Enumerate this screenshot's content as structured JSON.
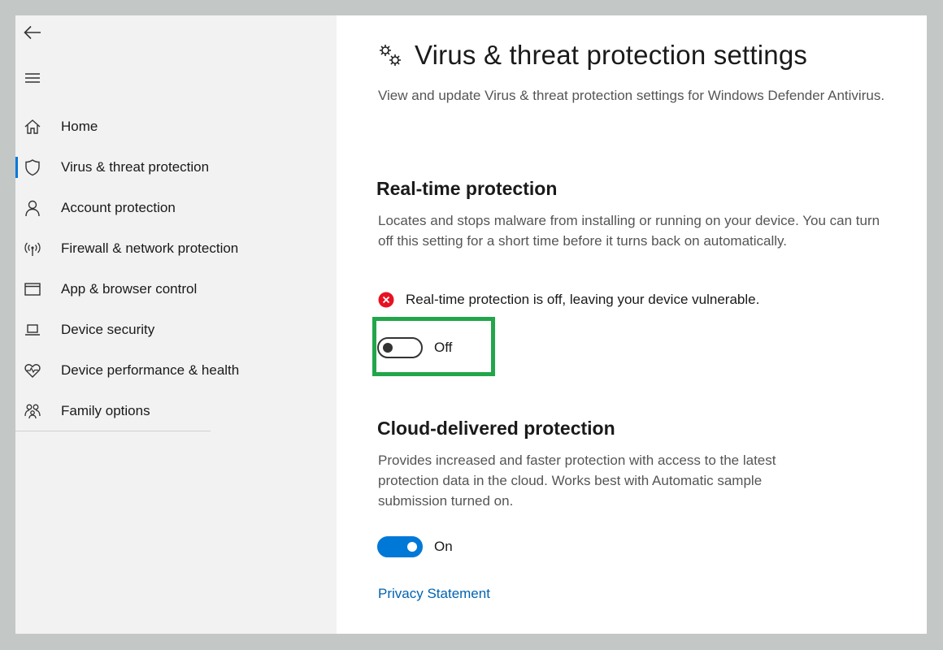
{
  "colors": {
    "accent": "#0078d7",
    "error": "#e81123",
    "highlight": "#22a64a",
    "link": "#0063b1"
  },
  "sidebar": {
    "back_icon": "back-arrow-icon",
    "menu_icon": "hamburger-menu-icon",
    "selected": "Virus & threat protection",
    "items": [
      {
        "label": "Home",
        "icon": "home-icon"
      },
      {
        "label": "Virus & threat protection",
        "icon": "shield-icon"
      },
      {
        "label": "Account protection",
        "icon": "person-icon"
      },
      {
        "label": "Firewall & network protection",
        "icon": "wireless-antenna-icon"
      },
      {
        "label": "App & browser control",
        "icon": "browser-window-icon"
      },
      {
        "label": "Device security",
        "icon": "laptop-icon"
      },
      {
        "label": "Device performance & health",
        "icon": "heart-pulse-icon"
      },
      {
        "label": "Family options",
        "icon": "family-icon"
      }
    ]
  },
  "main": {
    "title": "Virus & threat protection settings",
    "title_icon": "gears-icon",
    "description": "View and update Virus & threat protection settings for Windows Defender Antivirus.",
    "realtime": {
      "title": "Real-time protection",
      "description": "Locates and stops malware from installing or running on your device. You can turn off this setting for a short time before it turns back on automatically.",
      "warning": "Real-time protection is off, leaving your device vulnerable.",
      "warning_icon": "error-x-icon",
      "toggle_state": "Off"
    },
    "cloud": {
      "title": "Cloud-delivered protection",
      "description": "Provides increased and faster protection with access to the latest protection data in the cloud.  Works best with Automatic sample submission turned on.",
      "toggle_state": "On"
    },
    "privacy_link": "Privacy Statement"
  }
}
